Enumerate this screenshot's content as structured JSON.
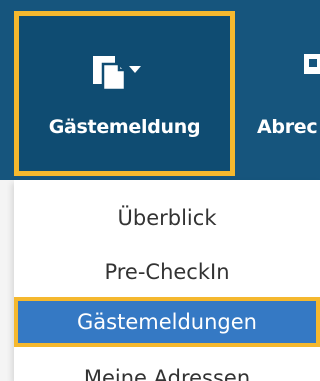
{
  "navbar": {
    "items": [
      {
        "label": "Gästemeldung",
        "icon": "document-icon",
        "active": true
      },
      {
        "label": "Abrec",
        "icon": "invoice-icon",
        "active": false
      }
    ]
  },
  "dropdown": {
    "items": [
      {
        "label": "Überblick",
        "selected": false
      },
      {
        "label": "Pre-CheckIn",
        "selected": false
      },
      {
        "label": "Gästemeldungen",
        "selected": true
      },
      {
        "label": "Meine Adressen",
        "selected": false
      }
    ]
  },
  "colors": {
    "nav_background": "#16557d",
    "active_background": "#0f4c72",
    "highlight_border": "#f5b82e",
    "selected_item": "#3579c4"
  }
}
